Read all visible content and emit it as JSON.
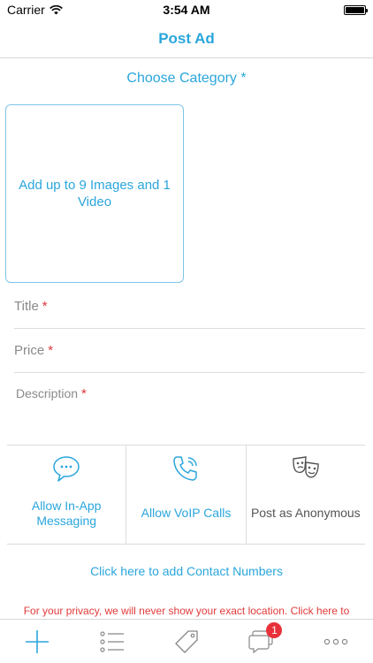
{
  "status_bar": {
    "carrier": "Carrier",
    "time": "3:54 AM"
  },
  "nav": {
    "title": "Post Ad"
  },
  "form": {
    "category_label": "Choose Category *",
    "media_prompt": "Add up to 9 Images and 1 Video",
    "title_label": "Title",
    "price_label": "Price",
    "description_label": "Description",
    "required_mark": "*"
  },
  "options": [
    {
      "label": "Allow In-App Messaging",
      "icon": "chat-bubble-icon"
    },
    {
      "label": "Allow VoIP Calls",
      "icon": "phone-icon"
    },
    {
      "label": "Post as Anonymous",
      "icon": "masks-icon"
    }
  ],
  "contact_link": "Click here to add Contact Numbers",
  "privacy_text": "For your privacy, we will never show your exact location.  Click here to",
  "tab_bar": {
    "tabs": [
      {
        "name": "post",
        "icon": "plus-icon"
      },
      {
        "name": "listings",
        "icon": "list-icon"
      },
      {
        "name": "offers",
        "icon": "tag-icon"
      },
      {
        "name": "messages",
        "icon": "messages-icon"
      },
      {
        "name": "more",
        "icon": "more-icon"
      }
    ],
    "messages_badge": "1"
  },
  "colors": {
    "accent": "#2aa6dc",
    "required": "#e0353a",
    "privacy": "#e23a3a",
    "badge": "#e8313a"
  }
}
